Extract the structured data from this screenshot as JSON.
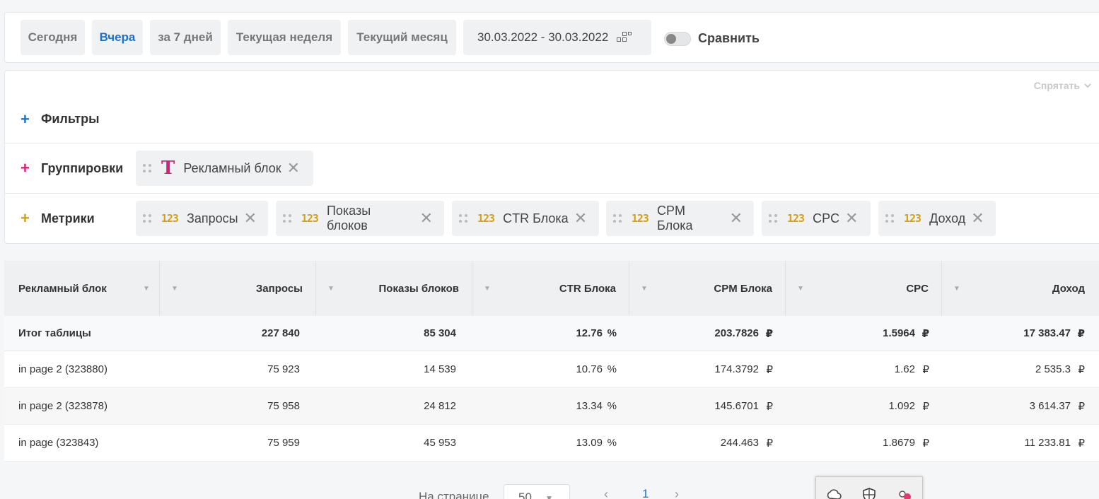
{
  "period": {
    "buttons": [
      "Сегодня",
      "Вчера",
      "за 7 дней",
      "Текущая неделя",
      "Текущий месяц"
    ],
    "active_index": 1,
    "date_range": "30.03.2022 - 30.03.2022",
    "compare_label": "Сравнить",
    "compare_enabled": false
  },
  "panel": {
    "hide_label": "Спрятать",
    "filters_label": "Фильтры",
    "groups_label": "Группировки",
    "metrics_label": "Метрики",
    "groups": [
      {
        "type_icon": "T",
        "label": "Рекламный блок"
      }
    ],
    "metrics": [
      {
        "type_icon": "123",
        "label": "Запросы"
      },
      {
        "type_icon": "123",
        "label": "Показы блоков"
      },
      {
        "type_icon": "123",
        "label": "CTR Блока"
      },
      {
        "type_icon": "123",
        "label": "CPM Блока"
      },
      {
        "type_icon": "123",
        "label": "CPC"
      },
      {
        "type_icon": "123",
        "label": "Доход"
      }
    ],
    "colors": {
      "filters_plus": "#1a73c8",
      "groups_plus": "#d0237a",
      "metrics_plus": "#d4a017"
    }
  },
  "table": {
    "columns": [
      "Рекламный блок",
      "Запросы",
      "Показы блоков",
      "CTR Блока",
      "CPM Блока",
      "CPC",
      "Доход"
    ],
    "total": {
      "label": "Итог таблицы",
      "values": [
        "227 840",
        "85 304",
        "12.76",
        "203.7826",
        "1.5964",
        "17 383.47"
      ]
    },
    "rows": [
      {
        "name": "in page 2 (323880)",
        "values": [
          "75 923",
          "14 539",
          "10.76",
          "174.3792",
          "1.62",
          "2 535.3"
        ]
      },
      {
        "name": "in page 2 (323878)",
        "values": [
          "75 958",
          "24 812",
          "13.34",
          "145.6701",
          "1.092",
          "3 614.37"
        ]
      },
      {
        "name": "in page (323843)",
        "values": [
          "75 959",
          "45 953",
          "13.09",
          "244.463",
          "1.8679",
          "11 233.81"
        ]
      }
    ],
    "units": [
      "",
      "",
      "%",
      "₽",
      "₽",
      "₽"
    ]
  },
  "pager": {
    "per_page_label": "На странице",
    "per_page_value": "50",
    "current_page": "1"
  }
}
